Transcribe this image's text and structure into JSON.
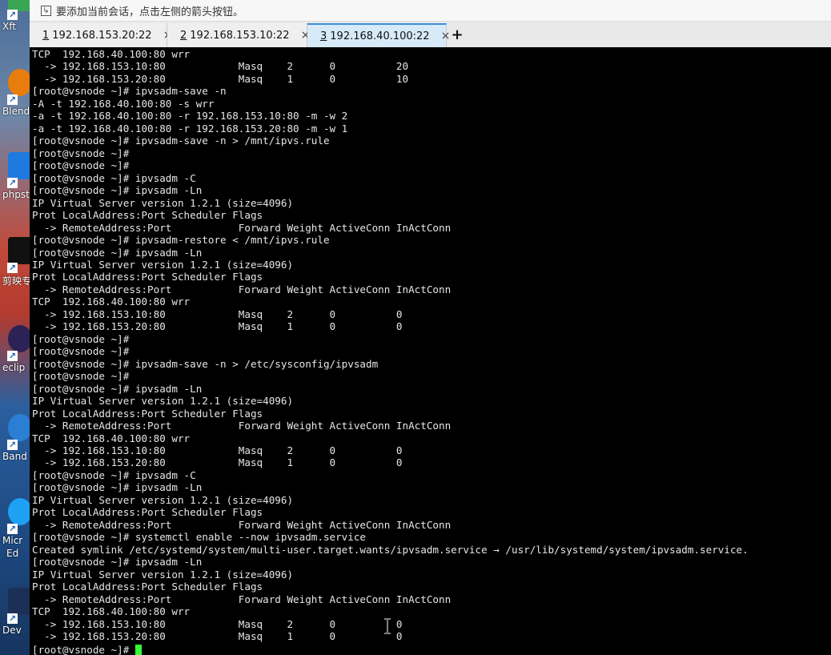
{
  "desktop": {
    "icons": [
      {
        "label": "Xft",
        "color": "#3aa655"
      },
      {
        "label": "Blend",
        "color": "#e87d0d"
      },
      {
        "label": "phpst",
        "color": "#1f7ae0"
      },
      {
        "label": "剪映专",
        "color": "#111111"
      },
      {
        "label": "eclip",
        "color": "#2c2255"
      },
      {
        "label": "Band",
        "color": "#2a7fd4"
      },
      {
        "label": "Micr",
        "color": "#1da1f2"
      },
      {
        "label": "Ed",
        "color": "#1da1f2"
      },
      {
        "label": "Dev",
        "color": "#1c2f55"
      }
    ]
  },
  "infobar": {
    "text": "要添加当前会话，点击左侧的箭头按钮。"
  },
  "tabs": [
    {
      "num": "1",
      "label": "192.168.153.20:22",
      "active": false
    },
    {
      "num": "2",
      "label": "192.168.153.10:22",
      "active": false
    },
    {
      "num": "3",
      "label": "192.168.40.100:22",
      "active": true
    }
  ],
  "tab_close_glyph": "×",
  "new_tab_glyph": "+",
  "colors": {
    "status_connected": "#2ecc40",
    "active_tab_bg": "#d6eaf8",
    "cursor": "#33ff33"
  },
  "terminal": {
    "prompt": "[root@vsnode ~]# ",
    "lines": [
      "TCP  192.168.40.100:80 wrr",
      "  -> 192.168.153.10:80            Masq    2      0          20",
      "  -> 192.168.153.20:80            Masq    1      0          10",
      "[root@vsnode ~]# ipvsadm-save -n",
      "-A -t 192.168.40.100:80 -s wrr",
      "-a -t 192.168.40.100:80 -r 192.168.153.10:80 -m -w 2",
      "-a -t 192.168.40.100:80 -r 192.168.153.20:80 -m -w 1",
      "[root@vsnode ~]# ipvsadm-save -n > /mnt/ipvs.rule",
      "[root@vsnode ~]#",
      "[root@vsnode ~]#",
      "[root@vsnode ~]# ipvsadm -C",
      "[root@vsnode ~]# ipvsadm -Ln",
      "IP Virtual Server version 1.2.1 (size=4096)",
      "Prot LocalAddress:Port Scheduler Flags",
      "  -> RemoteAddress:Port           Forward Weight ActiveConn InActConn",
      "[root@vsnode ~]# ipvsadm-restore < /mnt/ipvs.rule",
      "[root@vsnode ~]# ipvsadm -Ln",
      "IP Virtual Server version 1.2.1 (size=4096)",
      "Prot LocalAddress:Port Scheduler Flags",
      "  -> RemoteAddress:Port           Forward Weight ActiveConn InActConn",
      "TCP  192.168.40.100:80 wrr",
      "  -> 192.168.153.10:80            Masq    2      0          0",
      "  -> 192.168.153.20:80            Masq    1      0          0",
      "[root@vsnode ~]#",
      "[root@vsnode ~]#",
      "[root@vsnode ~]# ipvsadm-save -n > /etc/sysconfig/ipvsadm",
      "[root@vsnode ~]#",
      "[root@vsnode ~]# ipvsadm -Ln",
      "IP Virtual Server version 1.2.1 (size=4096)",
      "Prot LocalAddress:Port Scheduler Flags",
      "  -> RemoteAddress:Port           Forward Weight ActiveConn InActConn",
      "TCP  192.168.40.100:80 wrr",
      "  -> 192.168.153.10:80            Masq    2      0          0",
      "  -> 192.168.153.20:80            Masq    1      0          0",
      "[root@vsnode ~]# ipvsadm -C",
      "[root@vsnode ~]# ipvsadm -Ln",
      "IP Virtual Server version 1.2.1 (size=4096)",
      "Prot LocalAddress:Port Scheduler Flags",
      "  -> RemoteAddress:Port           Forward Weight ActiveConn InActConn",
      "[root@vsnode ~]# systemctl enable --now ipvsadm.service",
      "Created symlink /etc/systemd/system/multi-user.target.wants/ipvsadm.service → /usr/lib/systemd/system/ipvsadm.service.",
      "[root@vsnode ~]# ipvsadm -Ln",
      "IP Virtual Server version 1.2.1 (size=4096)",
      "Prot LocalAddress:Port Scheduler Flags",
      "  -> RemoteAddress:Port           Forward Weight ActiveConn InActConn",
      "TCP  192.168.40.100:80 wrr",
      "  -> 192.168.153.10:80            Masq    2      0          0",
      "  -> 192.168.153.20:80            Masq    1      0          0"
    ]
  }
}
